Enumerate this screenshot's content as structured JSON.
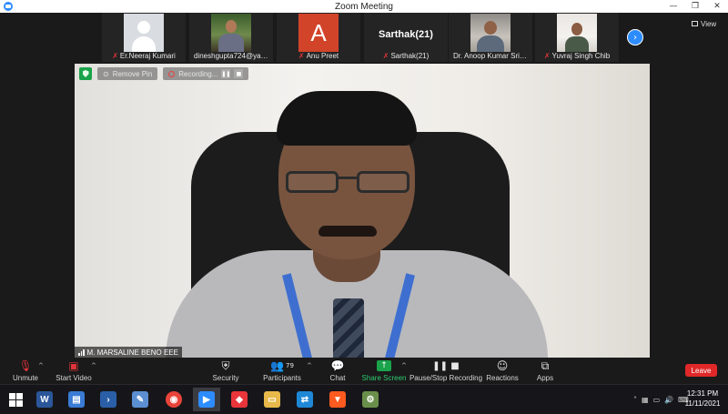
{
  "window": {
    "title": "Zoom Meeting",
    "controls": [
      "—",
      "❐",
      "✕"
    ]
  },
  "participants": [
    {
      "name": "Er.Neeraj Kumari",
      "muted": true,
      "avatar": "default-avatar"
    },
    {
      "name": "dineshgupta724@yahoo....",
      "muted": false,
      "avatar": "camera"
    },
    {
      "name": "Anu Preet",
      "muted": true,
      "avatar": "letter",
      "letter": "A",
      "color": "#d2442a"
    },
    {
      "name": "Sarthak(21)",
      "muted": true,
      "avatar": "name-only",
      "display_text": "Sarthak(21)"
    },
    {
      "name": "Dr. Anoop Kumar Srivast...",
      "muted": false,
      "avatar": "camera"
    },
    {
      "name": "Yuvraj Singh Chib",
      "muted": true,
      "avatar": "camera"
    }
  ],
  "strip_controls": {
    "next_icon": "chevron-right-icon",
    "view_label": "View"
  },
  "main_video": {
    "speaker_name": "M. MARSALINE BENO EEE",
    "remove_pin_label": "Remove Pin",
    "recording_label": "Recording..."
  },
  "toolbar": {
    "unmute": "Unmute",
    "start_video": "Start Video",
    "security": "Security",
    "participants": "Participants",
    "participants_count": "79",
    "chat": "Chat",
    "share_screen": "Share Screen",
    "record": "Pause/Stop Recording",
    "reactions": "Reactions",
    "apps": "Apps",
    "leave": "Leave"
  },
  "taskbar": {
    "time": "12:31 PM",
    "date": "11/11/2021",
    "apps": [
      {
        "name": "start-button"
      },
      {
        "name": "word",
        "color": "#2b579a",
        "glyph": "W"
      },
      {
        "name": "explorer-computer",
        "color": "#3a7bd5",
        "glyph": "▤"
      },
      {
        "name": "powershell",
        "color": "#2a5fa8",
        "glyph": "›"
      },
      {
        "name": "paint",
        "color": "#5b8fd1",
        "glyph": "✎"
      },
      {
        "name": "chrome",
        "color": "#e8443a",
        "glyph": "◉"
      },
      {
        "name": "zoom",
        "color": "#2d8cff",
        "glyph": "▶",
        "active": true
      },
      {
        "name": "anydesk",
        "color": "#e8353a",
        "glyph": "◆"
      },
      {
        "name": "file-explorer",
        "color": "#e8b94a",
        "glyph": "▭"
      },
      {
        "name": "remote-app",
        "color": "#1e88d6",
        "glyph": "⇄"
      },
      {
        "name": "brave",
        "color": "#ff5a1f",
        "glyph": "▼"
      },
      {
        "name": "utility",
        "color": "#6a8f4a",
        "glyph": "⚙"
      }
    ]
  },
  "colors": {
    "accent": "#2d8cff",
    "leave": "#e02828",
    "share": "#1aa34a",
    "muted": "#e0353a"
  }
}
